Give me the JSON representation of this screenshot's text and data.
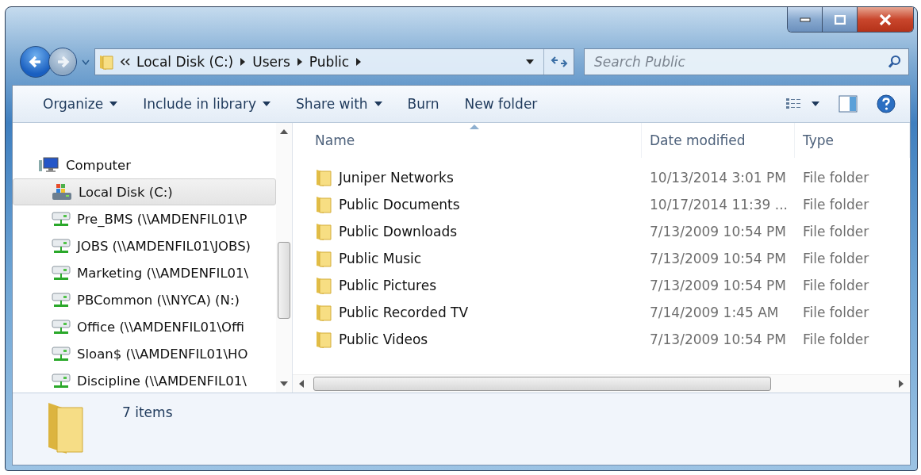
{
  "address": {
    "crumbs": [
      "Local Disk (C:)",
      "Users",
      "Public"
    ]
  },
  "search": {
    "placeholder": "Search Public"
  },
  "toolbar": {
    "items": [
      {
        "label": "Organize",
        "menu": true
      },
      {
        "label": "Include in library",
        "menu": true
      },
      {
        "label": "Share with",
        "menu": true
      },
      {
        "label": "Burn",
        "menu": false
      },
      {
        "label": "New folder",
        "menu": false
      }
    ]
  },
  "sidebar": {
    "items": [
      {
        "label": "Computer",
        "kind": "computer",
        "selected": false,
        "children": [
          {
            "label": "Local Disk (C:)",
            "kind": "disk",
            "selected": true
          },
          {
            "label": "Pre_BMS (\\\\AMDENFIL01\\P",
            "kind": "network",
            "selected": false
          },
          {
            "label": "JOBS (\\\\AMDENFIL01\\JOBS)",
            "kind": "network",
            "selected": false
          },
          {
            "label": "Marketing (\\\\AMDENFIL01\\",
            "kind": "network",
            "selected": false
          },
          {
            "label": "PBCommon (\\\\NYCA) (N:)",
            "kind": "network",
            "selected": false
          },
          {
            "label": "Office (\\\\AMDENFIL01\\Offi",
            "kind": "network",
            "selected": false
          },
          {
            "label": "Sloan$ (\\\\AMDENFIL01\\HO",
            "kind": "network",
            "selected": false
          },
          {
            "label": "Discipline (\\\\AMDENFIL01\\",
            "kind": "network",
            "selected": false
          }
        ]
      }
    ]
  },
  "table": {
    "columns": [
      "Name",
      "Date modified",
      "Type"
    ],
    "rows": [
      [
        "Juniper Networks",
        "10/13/2014 3:01 PM",
        "File folder"
      ],
      [
        "Public Documents",
        "10/17/2014 11:39 ...",
        "File folder"
      ],
      [
        "Public Downloads",
        "7/13/2009 10:54 PM",
        "File folder"
      ],
      [
        "Public Music",
        "7/13/2009 10:54 PM",
        "File folder"
      ],
      [
        "Public Pictures",
        "7/13/2009 10:54 PM",
        "File folder"
      ],
      [
        "Public Recorded TV",
        "7/14/2009 1:45 AM",
        "File folder"
      ],
      [
        "Public Videos",
        "7/13/2009 10:54 PM",
        "File folder"
      ]
    ]
  },
  "status_bar": {
    "text": "7 items"
  }
}
